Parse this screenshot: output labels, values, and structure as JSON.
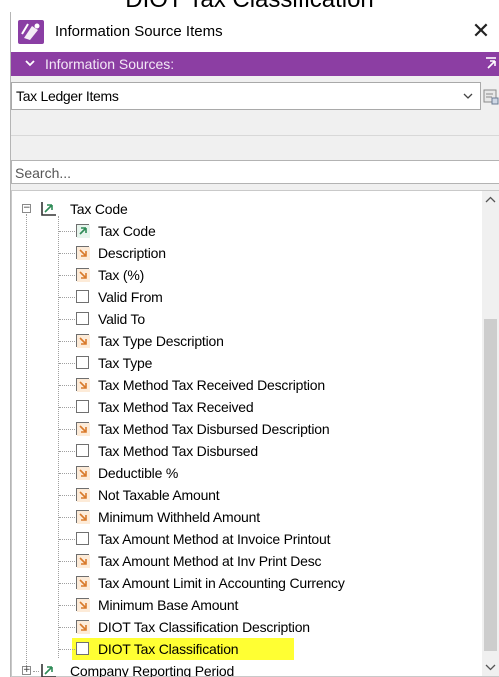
{
  "caption": "DIOT Tax Classification",
  "window": {
    "title": "Information Source Items",
    "close_glyph": "✕"
  },
  "sources_bar": {
    "label": "Information Sources:",
    "chevron_icon": "chevron-down-icon",
    "pin_icon": "pin-icon"
  },
  "source_select": {
    "value": "Tax Ledger Items"
  },
  "search": {
    "placeholder": "Search..."
  },
  "tree": {
    "root": {
      "label": "Tax Code",
      "expanded": true,
      "icon": "key-chart-icon"
    },
    "items": [
      {
        "label": "Tax Code",
        "icon": "key-field-icon"
      },
      {
        "label": "Description",
        "icon": "checked-field-icon"
      },
      {
        "label": "Tax (%)",
        "icon": "checked-field-icon"
      },
      {
        "label": "Valid From",
        "icon": "empty-field-icon"
      },
      {
        "label": "Valid To",
        "icon": "empty-field-icon"
      },
      {
        "label": "Tax Type Description",
        "icon": "checked-field-icon"
      },
      {
        "label": "Tax Type",
        "icon": "empty-field-icon"
      },
      {
        "label": "Tax Method Tax Received Description",
        "icon": "checked-field-icon"
      },
      {
        "label": "Tax Method Tax Received",
        "icon": "empty-field-icon"
      },
      {
        "label": "Tax Method Tax Disbursed Description",
        "icon": "checked-field-icon"
      },
      {
        "label": "Tax Method Tax Disbursed",
        "icon": "empty-field-icon"
      },
      {
        "label": "Deductible %",
        "icon": "checked-field-icon"
      },
      {
        "label": "Not Taxable Amount",
        "icon": "checked-field-icon"
      },
      {
        "label": "Minimum Withheld Amount",
        "icon": "checked-field-icon"
      },
      {
        "label": "Tax Amount Method at Invoice Printout",
        "icon": "empty-field-icon"
      },
      {
        "label": "Tax Amount Method at Inv Print Desc",
        "icon": "checked-field-icon"
      },
      {
        "label": "Tax Amount Limit in Accounting Currency",
        "icon": "checked-field-icon"
      },
      {
        "label": "Minimum Base Amount",
        "icon": "checked-field-icon"
      },
      {
        "label": "DIOT Tax Classification Description",
        "icon": "checked-field-icon"
      },
      {
        "label": "DIOT Tax Classification",
        "icon": "empty-field-icon",
        "highlighted": true
      }
    ],
    "next_root": {
      "label": "Company Reporting Period",
      "expanded": false,
      "icon": "key-chart-icon"
    }
  },
  "colors": {
    "accent": "#8c3ea3",
    "highlight": "#ffff33",
    "checked_icon": "#d97a2b",
    "key_icon": "#2e8b57"
  }
}
